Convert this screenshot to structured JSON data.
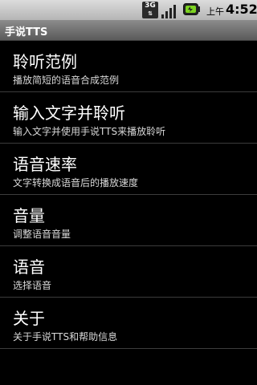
{
  "status_bar": {
    "network_badge": "3G",
    "ampm": "上午",
    "time": "4:52",
    "icons": [
      "3g-icon",
      "signal-icon",
      "battery-charging-icon"
    ]
  },
  "app": {
    "title": "手说TTS"
  },
  "menu": [
    {
      "label": "聆听范例",
      "sub": "播放简短的语音合成范例"
    },
    {
      "label": "输入文字并聆听",
      "sub": "输入文字并使用手说TTS来播放聆听"
    },
    {
      "label": "语音速率",
      "sub": "文字转换成语音后的播放速度"
    },
    {
      "label": "音量",
      "sub": "调整语音音量"
    },
    {
      "label": "语音",
      "sub": "选择语音"
    },
    {
      "label": "关于",
      "sub": "关于手说TTS和帮助信息"
    }
  ],
  "colors": {
    "background": "#000000",
    "titlebar": "#6e6e6e",
    "statusbar": "#c8c8c8",
    "battery_accent": "#7dd321"
  }
}
